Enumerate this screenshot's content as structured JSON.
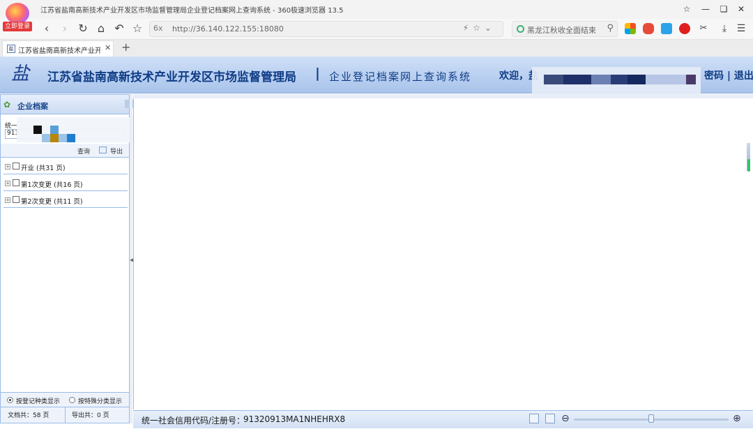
{
  "window": {
    "title": "江苏省盐南高新技术产业开发区市场监督管理局企业登记档案网上查询系统 - 360极速浏览器 13.5",
    "login_badge": "立即登录",
    "controls": [
      "shirt-icon",
      "minimize-icon",
      "restore-icon",
      "close-icon"
    ]
  },
  "address_bar": {
    "security_label": "6x",
    "url": "http://36.140.122.155:18080"
  },
  "search_box": {
    "text": "黑龙江秋收全面结束"
  },
  "tab": {
    "title": "江苏省盐南高新技术产业开发"
  },
  "banner": {
    "logo_text": "盐",
    "org_name": "江苏省盐南高新技术产业开发区市场监督管理局",
    "separator": "|",
    "system_name": "企业登记档案网上查询系统",
    "welcome": "欢迎，盐",
    "right_links": "密码 | 退出"
  },
  "sidebar": {
    "title": "企业档案",
    "field_label": "统一",
    "field_value": "913",
    "query_label": "查询",
    "export_label": "导出",
    "tree": [
      {
        "label": "开业 (共31 页)"
      },
      {
        "label": "第1次变更 (共16 页)"
      },
      {
        "label": "第2次变更 (共11 页)"
      }
    ],
    "footer": {
      "radio_by_category": "按登记种类显示",
      "radio_by_special": "按特殊分类显示",
      "docs_total": "文档共：58 页",
      "export_total": "导出共：0 页"
    }
  },
  "bottom": {
    "credit_label": "统一社会信用代码/注册号：",
    "credit_code": "91320913MA1NHEHRX8",
    "zoom_level": 0.5
  },
  "colors": {
    "banner_text": "#0f3c85",
    "panel_border": "#99bbe8",
    "login_badge": "#e4393c"
  }
}
